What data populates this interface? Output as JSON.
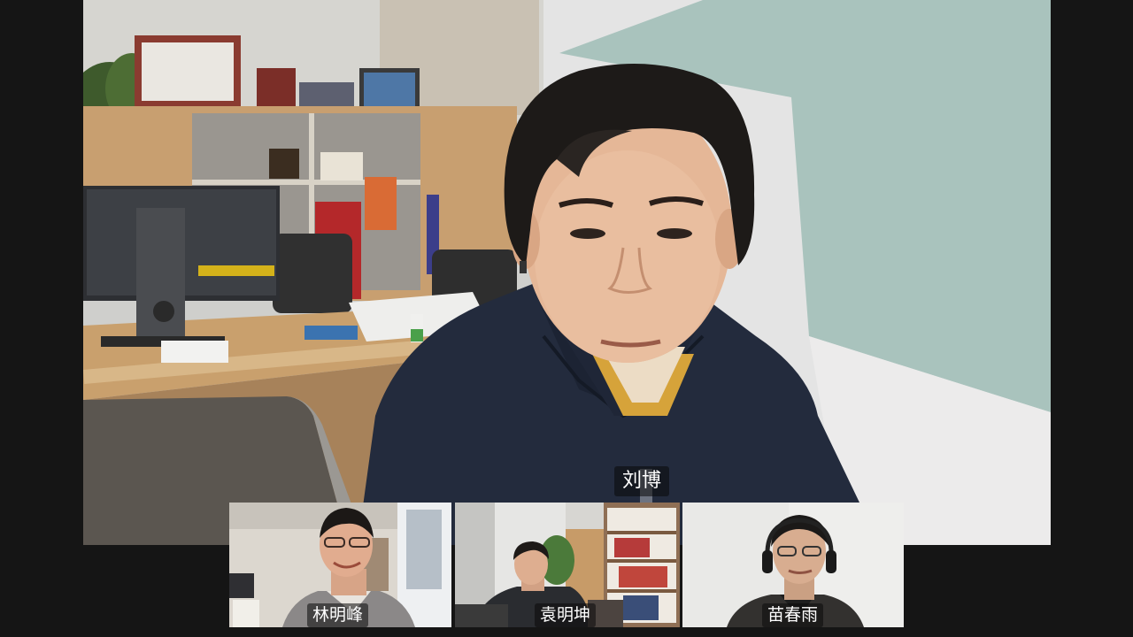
{
  "main_participant": {
    "name": "刘博",
    "speaking": true
  },
  "thumbnails": [
    {
      "name": "林明峰"
    },
    {
      "name": "袁明坤"
    },
    {
      "name": "苗春雨"
    }
  ],
  "colors": {
    "background": "#151515",
    "name_tag_bg": "rgba(10,10,10,0.55)",
    "name_tag_text": "#ffffff"
  }
}
